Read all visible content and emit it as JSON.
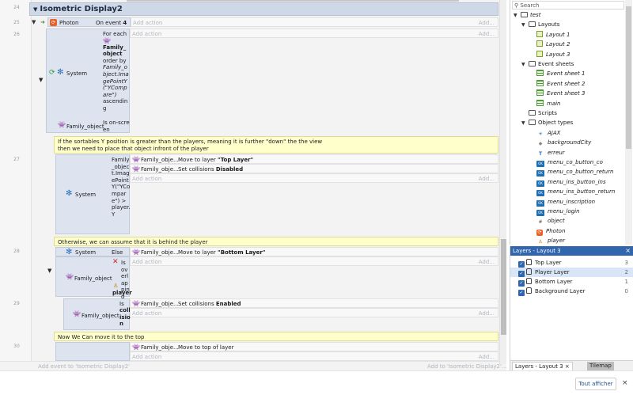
{
  "group": {
    "title": "Isometric Display2"
  },
  "line_numbers": [
    "24",
    "25",
    "26",
    "27",
    "28",
    "29",
    "30"
  ],
  "events": {
    "e25": {
      "object": "Photon",
      "condition_prefix": "On event",
      "condition_value": "4",
      "add_action": "Add action",
      "more": "Add..."
    },
    "e26": {
      "object": "System",
      "foreach_text": "For each",
      "foreach_obj": "Family_object",
      "order_text": "order by",
      "expr": "Family_object.ImagePointY(\"YCompare\")",
      "order_dir": "ascending",
      "cond2_obj": "Family_object",
      "cond2_text": "Is on-screen",
      "add_action": "Add action",
      "more": "Add..."
    },
    "comment1": {
      "line1": "If the sortables Y position is greater than the players, meaning it is further \"down\" the the view",
      "line2": "then we need to place that object infront of the player"
    },
    "e27": {
      "object": "System",
      "cond_text": "Family_object.ImagePointY(\"YCompare\") > player.Y",
      "actions": [
        {
          "obj": "Family_obje...",
          "prefix": "Move to layer",
          "value": "\"Top Layer\""
        },
        {
          "obj": "Family_obje...",
          "prefix": "Set collisions",
          "value": "Disabled"
        }
      ],
      "add_action": "Add action",
      "more": "Add..."
    },
    "comment2": {
      "text": "Otherwise, we can assume that it is behind the player"
    },
    "e28": {
      "system": "System",
      "else_text": "Else",
      "object": "Family_object",
      "overlap_text": "Is overlapping",
      "overlap_target": "player",
      "actions": [
        {
          "obj": "Family_obje...",
          "prefix": "Move to layer",
          "value": "\"Bottom Layer\""
        }
      ],
      "add_action": "Add action",
      "more": "Add..."
    },
    "e29": {
      "object": "Family_object",
      "cond_prefix": "Is",
      "cond_value": "collision",
      "actions": [
        {
          "obj": "Family_obje...",
          "prefix": "Set collisions",
          "value": "Enabled"
        }
      ],
      "add_action": "Add action",
      "more": "Add..."
    },
    "comment3": {
      "text": "Now We Can move it to the top"
    },
    "e30": {
      "actions": [
        {
          "obj": "Family_obje...",
          "text": "Move to top of layer"
        }
      ],
      "add_action": "Add action",
      "more": "Add..."
    }
  },
  "footer_hints": {
    "add_event": "Add event to 'Isometric Display2'",
    "add_to": "Add to 'Isometric Display2'..."
  },
  "project": {
    "search_placeholder": "Search",
    "tree": [
      {
        "label": "test",
        "kind": "folder",
        "italic": true,
        "caret": "▼"
      },
      {
        "label": "Layouts",
        "kind": "folder",
        "caret": "▼"
      },
      {
        "label": "Layout 1",
        "kind": "layout",
        "italic": true
      },
      {
        "label": "Layout 2",
        "kind": "layout",
        "italic": true
      },
      {
        "label": "Layout 3",
        "kind": "layout",
        "italic": true
      },
      {
        "label": "Event sheets",
        "kind": "folder",
        "caret": "▼"
      },
      {
        "label": "Event sheet 1",
        "kind": "sheet",
        "italic": true
      },
      {
        "label": "Event sheet 2",
        "kind": "sheet",
        "italic": true
      },
      {
        "label": "Event sheet 3",
        "kind": "sheet",
        "italic": true
      },
      {
        "label": "main",
        "kind": "sheet",
        "italic": true
      },
      {
        "label": "Scripts",
        "kind": "folder"
      },
      {
        "label": "Object types",
        "kind": "folder",
        "caret": "▼"
      },
      {
        "label": "AJAX",
        "kind": "ajax",
        "italic": true
      },
      {
        "label": "backgroundCity",
        "kind": "tiled",
        "italic": true
      },
      {
        "label": "erreur",
        "kind": "text",
        "italic": true
      },
      {
        "label": "menu_co_button_co",
        "kind": "button",
        "italic": true
      },
      {
        "label": "menu_co_button_return",
        "kind": "button",
        "italic": true
      },
      {
        "label": "menu_ins_button_ins",
        "kind": "button",
        "italic": true
      },
      {
        "label": "menu_ins_button_return",
        "kind": "button",
        "italic": true
      },
      {
        "label": "menu_inscription",
        "kind": "button",
        "italic": true
      },
      {
        "label": "menu_login",
        "kind": "button",
        "italic": true
      },
      {
        "label": "object",
        "kind": "family",
        "italic": true
      },
      {
        "label": "Photon",
        "kind": "photon",
        "italic": true
      },
      {
        "label": "player",
        "kind": "player",
        "italic": true
      }
    ]
  },
  "layers": {
    "title": "Layers - Layout 3",
    "items": [
      {
        "name": "Top Layer",
        "index": "3"
      },
      {
        "name": "Player Layer",
        "index": "2"
      },
      {
        "name": "Bottom Layer",
        "index": "1"
      },
      {
        "name": "Background Layer",
        "index": "0"
      }
    ],
    "tabs": [
      "Layers - Layout 3",
      "Tilemap"
    ]
  },
  "footer": {
    "show_button": "Tout afficher"
  },
  "icons": {
    "close": "×",
    "search": "🔍"
  },
  "colors": {
    "accent": "#2f66ad",
    "comment_bg": "#ffffcc",
    "condition_bg": "#dde4ef"
  }
}
